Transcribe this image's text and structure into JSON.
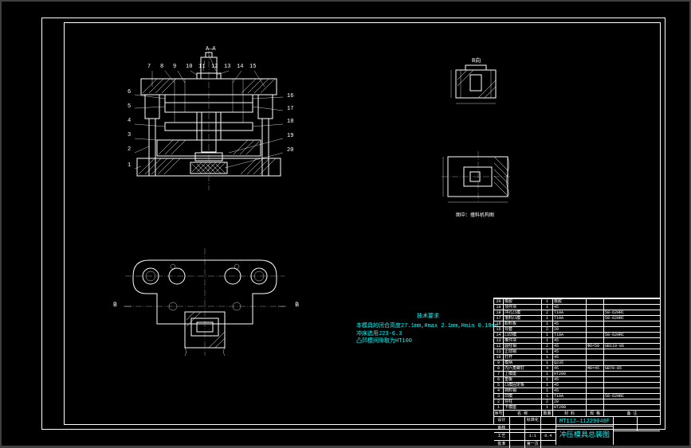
{
  "drawing": {
    "section_label": "A—A",
    "detail_top_label": "B向",
    "detail_side_caption": "图中：撞料机构图",
    "leader_numbers_top": [
      "7",
      "8",
      "9",
      "10",
      "11",
      "12",
      "13",
      "14",
      "15"
    ],
    "leader_numbers_left": [
      "6",
      "5",
      "4",
      "3",
      "2",
      "1"
    ],
    "leader_numbers_right": [
      "16",
      "17",
      "18",
      "19",
      "20"
    ],
    "plan_arrow_left": "B",
    "plan_arrow_right": "B"
  },
  "tech_req": {
    "title": "技术要求",
    "line1": "本模具的闭合高度27.1mm,Hmax 2.1mm,Hmin 0.18mm",
    "line2": "冲床选用J23-6.3",
    "line3": "凸凹模间隙取为HT100"
  },
  "title_block": {
    "drawing_number": "MT112—11229048F",
    "drawing_title": "冲压模具总装图",
    "sheet": "第一页",
    "scale": "1:1",
    "weight": "0.4",
    "header": {
      "num": "序号",
      "name": "名 称",
      "qty": "数量",
      "mat": "材 料",
      "std": "规 格",
      "note": "备 注"
    },
    "sign_labels": {
      "design": "设计",
      "check": "审核",
      "process": "工艺",
      "approve": "批准",
      "std_check": "标准化",
      "date": "日期"
    }
  },
  "parts": [
    {
      "num": "1",
      "name": "下模座",
      "qty": "1",
      "mat": "HT200",
      "std": "",
      "note": ""
    },
    {
      "num": "2",
      "name": "导柱",
      "qty": "2",
      "mat": "20",
      "std": "",
      "note": ""
    },
    {
      "num": "3",
      "name": "凹模",
      "qty": "1",
      "mat": "T10A",
      "std": "",
      "note": "58-62HRC"
    },
    {
      "num": "4",
      "name": "挡料销",
      "qty": "1",
      "mat": "45",
      "std": "",
      "note": ""
    },
    {
      "num": "5",
      "name": "凸模固定板",
      "qty": "1",
      "mat": "45",
      "std": "",
      "note": ""
    },
    {
      "num": "6",
      "name": "垫板",
      "qty": "1",
      "mat": "45",
      "std": "",
      "note": ""
    },
    {
      "num": "7",
      "name": "上模座",
      "qty": "1",
      "mat": "HT200",
      "std": "",
      "note": ""
    },
    {
      "num": "8",
      "name": "内六角螺钉",
      "qty": "4",
      "mat": "45",
      "std": "M8×45",
      "note": "GB70-85"
    },
    {
      "num": "9",
      "name": "模柄",
      "qty": "1",
      "mat": "Q235",
      "std": "",
      "note": ""
    },
    {
      "num": "10",
      "name": "打杆",
      "qty": "1",
      "mat": "45",
      "std": "",
      "note": ""
    },
    {
      "num": "11",
      "name": "止动销",
      "qty": "1",
      "mat": "45",
      "std": "",
      "note": ""
    },
    {
      "num": "12",
      "name": "圆柱销",
      "qty": "2",
      "mat": "45",
      "std": "Φ6×50",
      "note": "GB119-86"
    },
    {
      "num": "13",
      "name": "推件块",
      "qty": "1",
      "mat": "45",
      "std": "",
      "note": ""
    },
    {
      "num": "14",
      "name": "凸凹模",
      "qty": "1",
      "mat": "T10A",
      "std": "",
      "note": "58-62HRC"
    },
    {
      "num": "15",
      "name": "导套",
      "qty": "2",
      "mat": "20",
      "std": "",
      "note": ""
    },
    {
      "num": "16",
      "name": "卸料板",
      "qty": "1",
      "mat": "45",
      "std": "",
      "note": ""
    },
    {
      "num": "17",
      "name": "落料凸模",
      "qty": "1",
      "mat": "T10A",
      "std": "",
      "note": "58-62HRC"
    },
    {
      "num": "18",
      "name": "冲孔凸模",
      "qty": "2",
      "mat": "T10A",
      "std": "",
      "note": "58-62HRC"
    },
    {
      "num": "19",
      "name": "顶件块",
      "qty": "1",
      "mat": "45",
      "std": "",
      "note": ""
    },
    {
      "num": "20",
      "name": "橡胶",
      "qty": "1",
      "mat": "橡胶",
      "std": "",
      "note": ""
    }
  ]
}
